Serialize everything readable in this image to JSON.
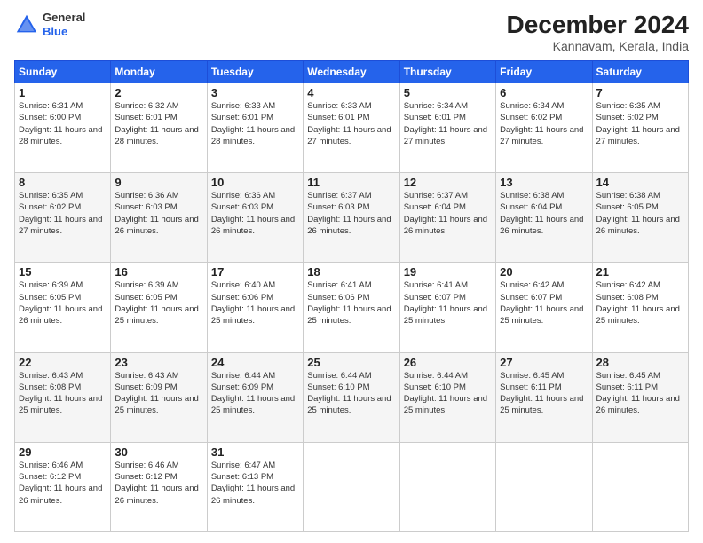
{
  "header": {
    "logo_general": "General",
    "logo_blue": "Blue",
    "title": "December 2024",
    "location": "Kannavam, Kerala, India"
  },
  "weekdays": [
    "Sunday",
    "Monday",
    "Tuesday",
    "Wednesday",
    "Thursday",
    "Friday",
    "Saturday"
  ],
  "weeks": [
    [
      {
        "day": "1",
        "sunrise": "6:31 AM",
        "sunset": "6:00 PM",
        "daylight": "11 hours and 28 minutes."
      },
      {
        "day": "2",
        "sunrise": "6:32 AM",
        "sunset": "6:01 PM",
        "daylight": "11 hours and 28 minutes."
      },
      {
        "day": "3",
        "sunrise": "6:33 AM",
        "sunset": "6:01 PM",
        "daylight": "11 hours and 28 minutes."
      },
      {
        "day": "4",
        "sunrise": "6:33 AM",
        "sunset": "6:01 PM",
        "daylight": "11 hours and 27 minutes."
      },
      {
        "day": "5",
        "sunrise": "6:34 AM",
        "sunset": "6:01 PM",
        "daylight": "11 hours and 27 minutes."
      },
      {
        "day": "6",
        "sunrise": "6:34 AM",
        "sunset": "6:02 PM",
        "daylight": "11 hours and 27 minutes."
      },
      {
        "day": "7",
        "sunrise": "6:35 AM",
        "sunset": "6:02 PM",
        "daylight": "11 hours and 27 minutes."
      }
    ],
    [
      {
        "day": "8",
        "sunrise": "6:35 AM",
        "sunset": "6:02 PM",
        "daylight": "11 hours and 27 minutes."
      },
      {
        "day": "9",
        "sunrise": "6:36 AM",
        "sunset": "6:03 PM",
        "daylight": "11 hours and 26 minutes."
      },
      {
        "day": "10",
        "sunrise": "6:36 AM",
        "sunset": "6:03 PM",
        "daylight": "11 hours and 26 minutes."
      },
      {
        "day": "11",
        "sunrise": "6:37 AM",
        "sunset": "6:03 PM",
        "daylight": "11 hours and 26 minutes."
      },
      {
        "day": "12",
        "sunrise": "6:37 AM",
        "sunset": "6:04 PM",
        "daylight": "11 hours and 26 minutes."
      },
      {
        "day": "13",
        "sunrise": "6:38 AM",
        "sunset": "6:04 PM",
        "daylight": "11 hours and 26 minutes."
      },
      {
        "day": "14",
        "sunrise": "6:38 AM",
        "sunset": "6:05 PM",
        "daylight": "11 hours and 26 minutes."
      }
    ],
    [
      {
        "day": "15",
        "sunrise": "6:39 AM",
        "sunset": "6:05 PM",
        "daylight": "11 hours and 26 minutes."
      },
      {
        "day": "16",
        "sunrise": "6:39 AM",
        "sunset": "6:05 PM",
        "daylight": "11 hours and 25 minutes."
      },
      {
        "day": "17",
        "sunrise": "6:40 AM",
        "sunset": "6:06 PM",
        "daylight": "11 hours and 25 minutes."
      },
      {
        "day": "18",
        "sunrise": "6:41 AM",
        "sunset": "6:06 PM",
        "daylight": "11 hours and 25 minutes."
      },
      {
        "day": "19",
        "sunrise": "6:41 AM",
        "sunset": "6:07 PM",
        "daylight": "11 hours and 25 minutes."
      },
      {
        "day": "20",
        "sunrise": "6:42 AM",
        "sunset": "6:07 PM",
        "daylight": "11 hours and 25 minutes."
      },
      {
        "day": "21",
        "sunrise": "6:42 AM",
        "sunset": "6:08 PM",
        "daylight": "11 hours and 25 minutes."
      }
    ],
    [
      {
        "day": "22",
        "sunrise": "6:43 AM",
        "sunset": "6:08 PM",
        "daylight": "11 hours and 25 minutes."
      },
      {
        "day": "23",
        "sunrise": "6:43 AM",
        "sunset": "6:09 PM",
        "daylight": "11 hours and 25 minutes."
      },
      {
        "day": "24",
        "sunrise": "6:44 AM",
        "sunset": "6:09 PM",
        "daylight": "11 hours and 25 minutes."
      },
      {
        "day": "25",
        "sunrise": "6:44 AM",
        "sunset": "6:10 PM",
        "daylight": "11 hours and 25 minutes."
      },
      {
        "day": "26",
        "sunrise": "6:44 AM",
        "sunset": "6:10 PM",
        "daylight": "11 hours and 25 minutes."
      },
      {
        "day": "27",
        "sunrise": "6:45 AM",
        "sunset": "6:11 PM",
        "daylight": "11 hours and 25 minutes."
      },
      {
        "day": "28",
        "sunrise": "6:45 AM",
        "sunset": "6:11 PM",
        "daylight": "11 hours and 26 minutes."
      }
    ],
    [
      {
        "day": "29",
        "sunrise": "6:46 AM",
        "sunset": "6:12 PM",
        "daylight": "11 hours and 26 minutes."
      },
      {
        "day": "30",
        "sunrise": "6:46 AM",
        "sunset": "6:12 PM",
        "daylight": "11 hours and 26 minutes."
      },
      {
        "day": "31",
        "sunrise": "6:47 AM",
        "sunset": "6:13 PM",
        "daylight": "11 hours and 26 minutes."
      },
      null,
      null,
      null,
      null
    ]
  ]
}
